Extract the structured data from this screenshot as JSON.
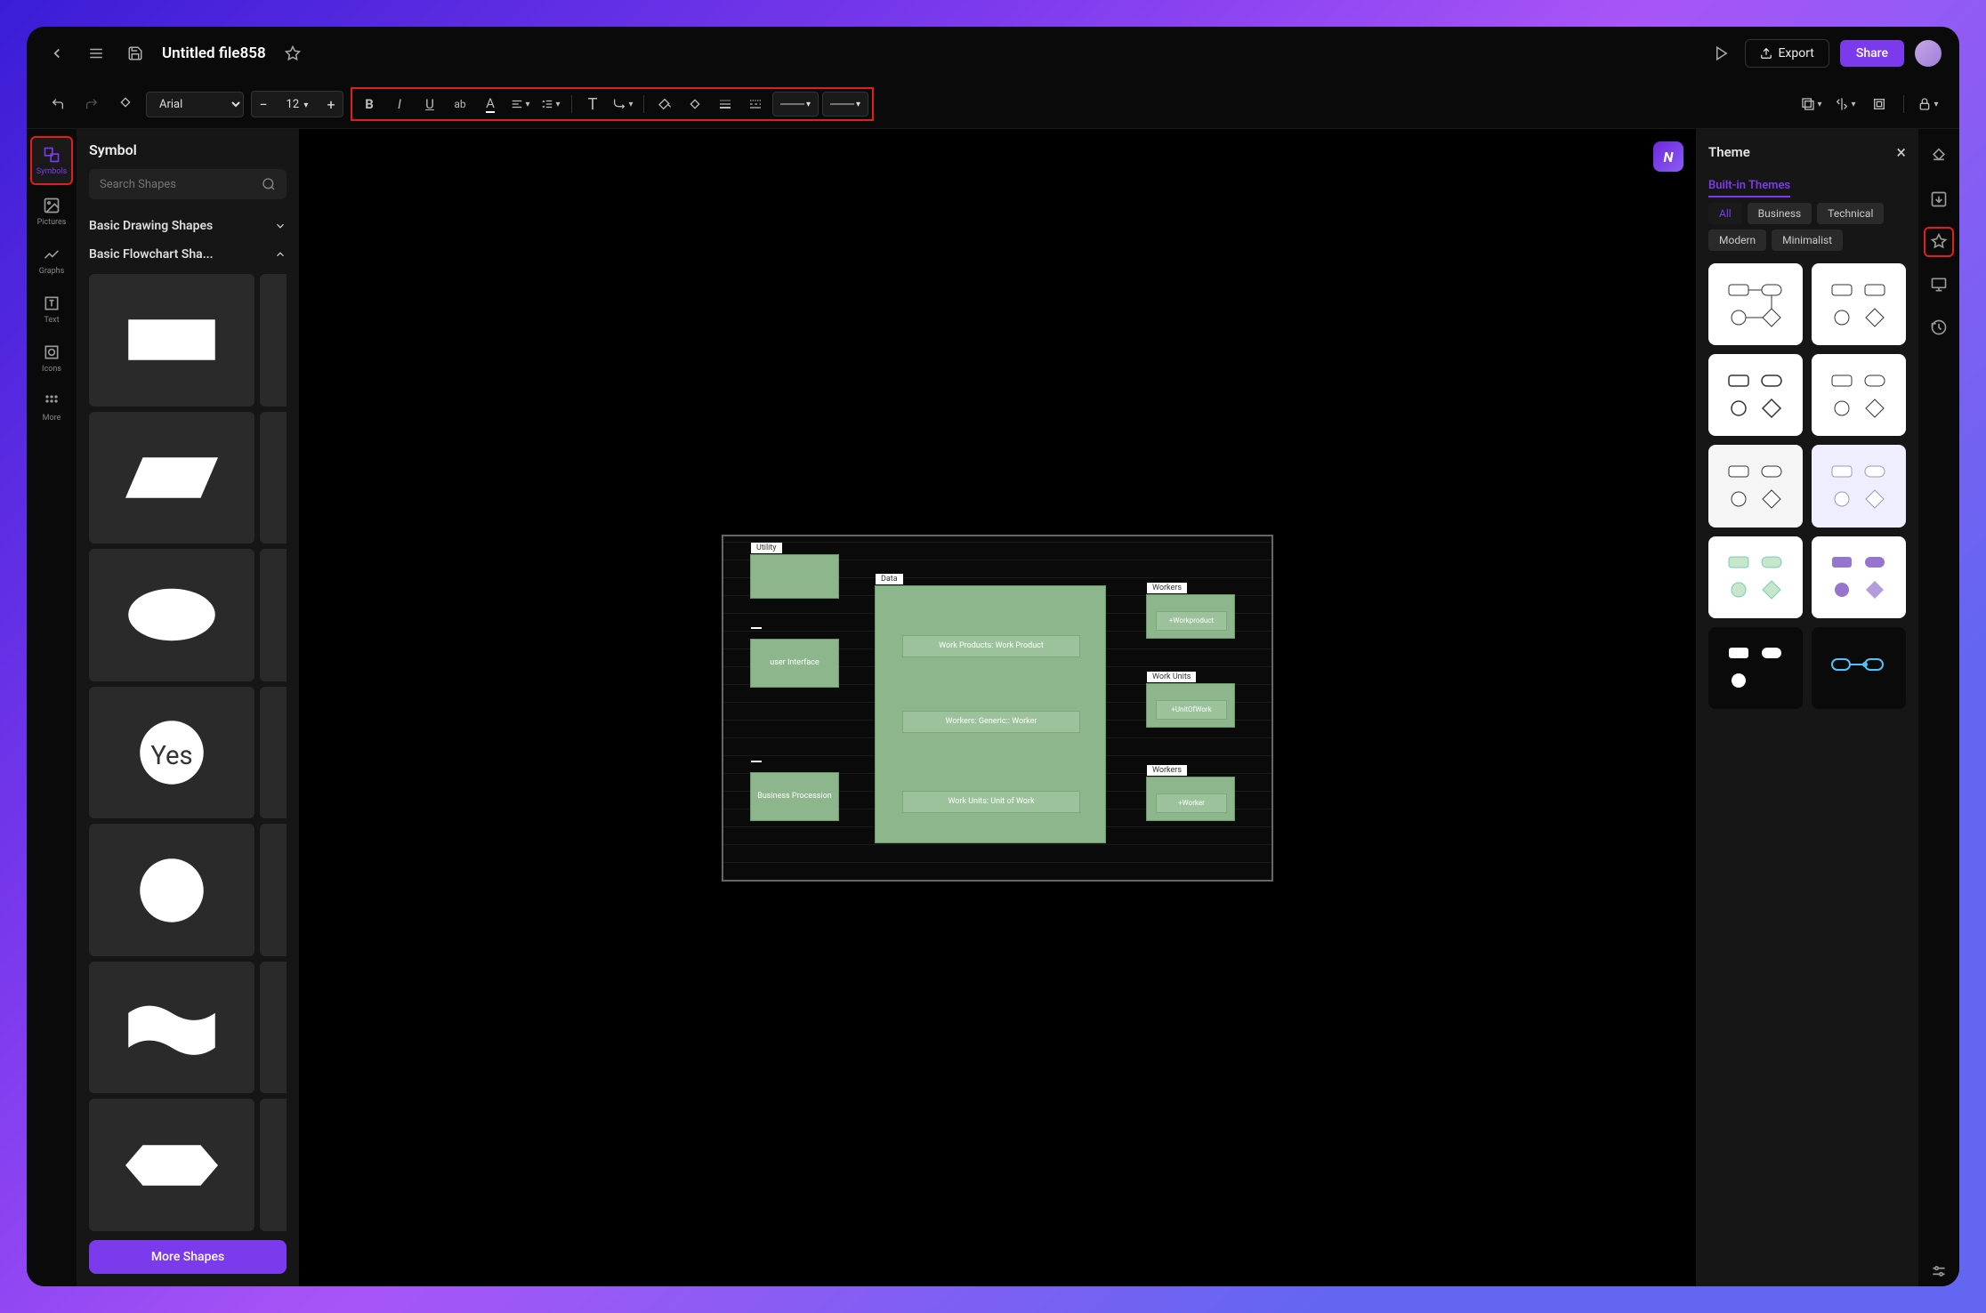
{
  "header": {
    "file_title": "Untitled file858",
    "export_label": "Export",
    "share_label": "Share"
  },
  "toolbar": {
    "font_name": "Arial",
    "font_size": "12"
  },
  "left_rail": [
    {
      "label": "Symbols",
      "active": true,
      "highlighted": true
    },
    {
      "label": "Pictures",
      "active": false
    },
    {
      "label": "Graphs",
      "active": false
    },
    {
      "label": "Text",
      "active": false
    },
    {
      "label": "Icons",
      "active": false
    },
    {
      "label": "More",
      "active": false
    }
  ],
  "symbol_panel": {
    "title": "Symbol",
    "search_placeholder": "Search Shapes",
    "sections": {
      "basic_drawing": "Basic Drawing Shapes",
      "basic_flowchart": "Basic Flowchart Sha..."
    },
    "more_shapes_label": "More Shapes",
    "yes_label": "Yes"
  },
  "canvas": {
    "boxes": {
      "utility": "Utility",
      "user_interface": "user Interface",
      "business": "Business Procession",
      "data": "Data",
      "work_products": "Work Products: Work Product",
      "workers_generic": "Workers: Generic:: Worker",
      "work_units": "Work Units: Unit of Work",
      "workers": "Workers",
      "workproduct": "+Workproduct",
      "work_units_label": "Work Units",
      "unitofwork": "+UnitOfWork",
      "worker": "+Worker"
    }
  },
  "theme_panel": {
    "title": "Theme",
    "tab": "Built-in Themes",
    "filters": [
      "All",
      "Business",
      "Technical",
      "Modern",
      "Minimalist"
    ]
  }
}
